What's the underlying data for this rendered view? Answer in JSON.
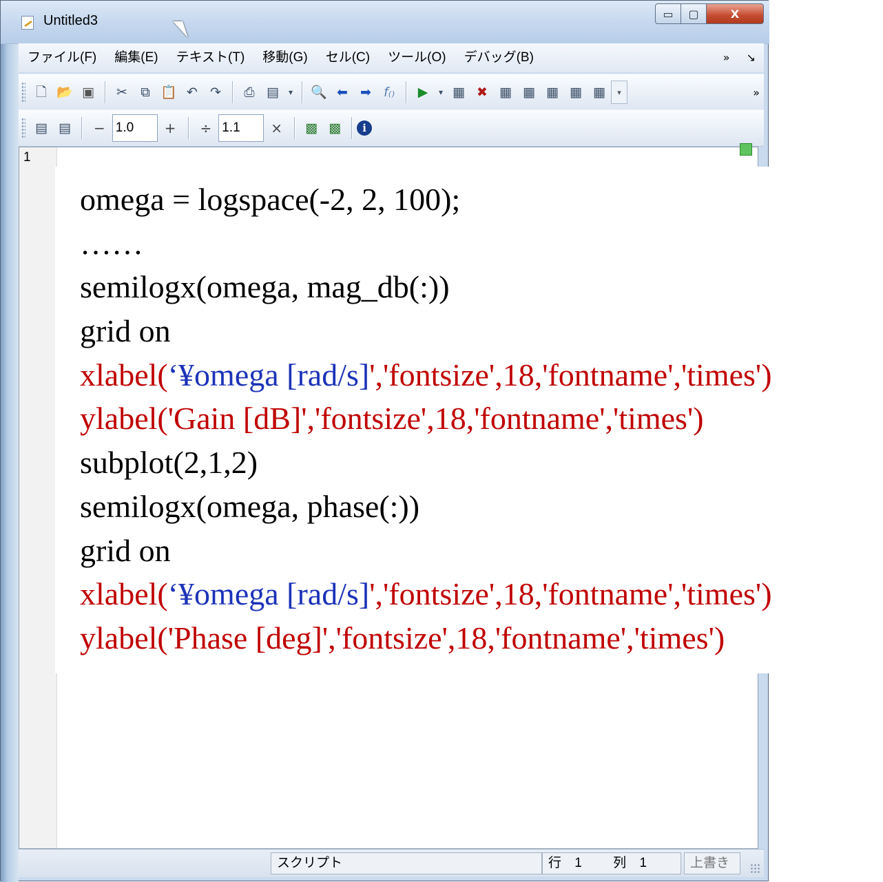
{
  "window": {
    "title": "Untitled3",
    "controls": {
      "minimize": "▭",
      "maximize": "▢",
      "close": "X"
    }
  },
  "menu": {
    "items": [
      "ファイル(F)",
      "編集(E)",
      "テキスト(T)",
      "移動(G)",
      "セル(C)",
      "ツール(O)",
      "デバッグ(B)"
    ],
    "overflow": "»",
    "overflow_arrow": "↘"
  },
  "toolbar2": {
    "decrement_label": "−",
    "increment_value": "1.0",
    "increment_label": "+",
    "divide_label": "÷",
    "divide_value": "1.1",
    "multiply_label": "×"
  },
  "editor": {
    "line_number": "1"
  },
  "code": {
    "line1": "omega = logspace(-2, 2, 100);",
    "line2": "……",
    "line3": "semilogx(omega, mag_db(:))",
    "line4": "grid on",
    "line5_a": "xlabel(",
    "line5_b": "‘¥omega [rad/s]",
    "line5_c": "','fontsize',18,'fontname','times')",
    "line6": "ylabel('Gain [dB]','fontsize',18,'fontname','times')",
    "line7": "subplot(2,1,2)",
    "line8": "semilogx(omega, phase(:))",
    "line9": "grid on",
    "line10_a": "xlabel(",
    "line10_b": "‘¥omega [rad/s]",
    "line10_c": "','fontsize',18,'fontname','times')",
    "line11": "ylabel('Phase [deg]','fontsize',18,'fontname','times')"
  },
  "status": {
    "mode": "スクリプト",
    "row_label": "行",
    "row_value": "1",
    "col_label": "列",
    "col_value": "1",
    "overwrite": "上書き"
  },
  "colors": {
    "code_red": "#c00000",
    "code_blue": "#1c33b8",
    "code_black": "#000000"
  }
}
